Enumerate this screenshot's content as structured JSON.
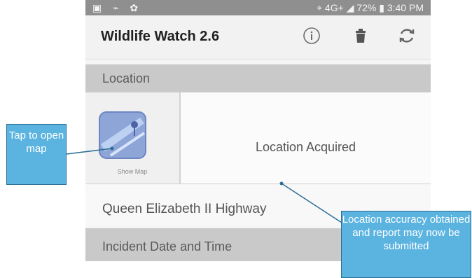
{
  "status_bar": {
    "left_icons": [
      "gallery-icon",
      "voicemail-icon",
      "android-icon"
    ],
    "signal_text": "4G+",
    "battery": "72%",
    "time": "3:40 PM"
  },
  "app_bar": {
    "title": "Wildlife Watch 2.6",
    "actions": [
      "info-icon",
      "trash-icon",
      "refresh-icon"
    ]
  },
  "location_section": {
    "header": "Location",
    "map_button_label": "Show Map",
    "status": "Location Acquired",
    "road": "Queen Elizabeth II Highway"
  },
  "incident_section": {
    "header": "Incident Date and Time"
  },
  "annotations": {
    "map_callout": "Tap to open map",
    "accuracy_callout": "Location accuracy obtained and report may now be submitted"
  },
  "colors": {
    "callout_fill": "#5bb3e0",
    "callout_border": "#2d6f97",
    "header_gray": "#c9c9c9",
    "status_bar": "#8f8f8f"
  }
}
